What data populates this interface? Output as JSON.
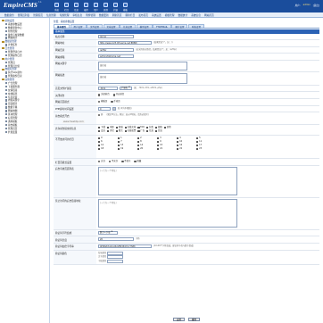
{
  "app": {
    "logo": "EmpireCMS",
    "logo_sub": "7.5",
    "user_label": "用户:",
    "username": "admin",
    "logout": "[退出]"
  },
  "topnav": [
    "系统",
    "栏目",
    "信息",
    "插件",
    "用户",
    "其他",
    "扩展",
    "模板"
  ],
  "menubar": [
    "数据备份",
    "管理员列表",
    "管理首页",
    "信息管理",
    "专题管理",
    "审核信息",
    "附件管理",
    "数据更新",
    "刷新首页",
    "刷新栏目",
    "发布首页",
    "系统设置",
    "模板管理",
    "数据统计",
    "系统信息",
    "网站首页"
  ],
  "sidebar": [
    {
      "label": "系统设置",
      "level": 1,
      "t": "f"
    },
    {
      "label": "系统参数设置",
      "level": 2,
      "t": "p"
    },
    {
      "label": "数据更新中心",
      "level": 2,
      "t": "p"
    },
    {
      "label": "附件管理",
      "level": 2,
      "t": "p"
    },
    {
      "label": "备份与恢复数据",
      "level": 2,
      "t": "p"
    },
    {
      "label": "网站统计",
      "level": 2,
      "t": "p"
    },
    {
      "label": "数据表管理",
      "level": 1,
      "t": "f"
    },
    {
      "label": "计划任务",
      "level": 2,
      "t": "p"
    },
    {
      "label": "日志管理",
      "level": 1,
      "t": "f"
    },
    {
      "label": "管理登录日志",
      "level": 2,
      "t": "p"
    },
    {
      "label": "管理操作日志",
      "level": 2,
      "t": "p"
    },
    {
      "label": "用户管理",
      "level": 1,
      "t": "f"
    },
    {
      "label": "管理员",
      "level": 2,
      "t": "p"
    },
    {
      "label": "管理员分组",
      "level": 2,
      "t": "p"
    },
    {
      "label": "数据库管理",
      "level": 1,
      "t": "f"
    },
    {
      "label": "执行SQL语句",
      "level": 2,
      "t": "p"
    },
    {
      "label": "管理备份目录",
      "level": 2,
      "t": "p"
    },
    {
      "label": "其他管理",
      "level": 1,
      "t": "f"
    },
    {
      "label": "广告管理",
      "level": 2,
      "t": "p"
    },
    {
      "label": "下载服务器",
      "level": 2,
      "t": "p"
    },
    {
      "label": "友情链接",
      "level": 2,
      "t": "p"
    },
    {
      "label": "在线投票",
      "level": 2,
      "t": "p"
    },
    {
      "label": "信息反馈",
      "level": 2,
      "t": "p"
    },
    {
      "label": "内容关键字",
      "level": 2,
      "t": "p"
    },
    {
      "label": "错误报告",
      "level": 2,
      "t": "p"
    },
    {
      "label": "数据字典",
      "level": 2,
      "t": "p"
    },
    {
      "label": "网站地图",
      "level": 2,
      "t": "p"
    },
    {
      "label": "区块管理",
      "level": 2,
      "t": "p"
    },
    {
      "label": "标签管理",
      "level": 2,
      "t": "p"
    },
    {
      "label": "通用模板",
      "level": 2,
      "t": "p"
    },
    {
      "label": "前台模板",
      "level": 2,
      "t": "p"
    },
    {
      "label": "管理首页",
      "level": 2,
      "t": "p"
    },
    {
      "label": "扩展变量",
      "level": 2,
      "t": "p"
    }
  ],
  "main": {
    "crumb": "位置：系统参数设置",
    "tabs": [
      "基本属性",
      "用户设置",
      "文件设置",
      "文章设置",
      "信息设置",
      "模型设置",
      "FTP/EMAIL",
      "图片设置",
      "附加设置"
    ],
    "section": "基本属性",
    "r_sitename_l": "站点名称",
    "r_sitename_v": "演示站",
    "r_url_l": "网站地址",
    "r_url_v": "http://www.123.0fcusma.net:8888/",
    "r_url_h": "(结尾需加\"/\"，如：/)",
    "r_path_l": "网站目录",
    "r_path_v": "/e/ftp/",
    "r_path_h": "(应采用绝对路径，结尾需加\"/\"，如：/e/ftp/)",
    "r_email_l": "网站邮箱",
    "r_email_v": "admin@phome.net",
    "r_kw_l": "网站关键字",
    "r_kw_v": "演示站",
    "r_desc_l": "网站描述",
    "r_desc_v": "演示站",
    "r_ext_l": "首页文件扩展名",
    "r_ext_v": ".html",
    "r_ext_sel": "扩展名",
    "r_ext_h": "(如：.html,.htm,.shtml,.php)",
    "r_close_l": "关闭前台",
    "r_close_o1": "关闭前台",
    "r_close_o2": "开启前台",
    "r_mode_l": "网站首页模式",
    "r_mode_o1": "模板页",
    "r_mode_o2": "手动页",
    "r_php_l": "PHP超时时间设置",
    "r_php_v": "0",
    "r_php_h": "秒 (0为不限制)",
    "r_ip_l": "前台模式开启",
    "r_ip_v": "开",
    "r_ip_h": "(限定IP方法，例如：如以IP地址，请务必填写)",
    "watermark": "www.hwsbtp.com",
    "r_cb_l": "允许前台提交的信息",
    "r_cb_row1": [
      "下载",
      "电影",
      "商城",
      "在线文章",
      "FAQ",
      "分类",
      "投稿",
      "其他"
    ],
    "r_cb_row2": [
      "会员",
      "评论",
      "留言",
      "在线投票",
      "广告",
      "信息",
      "信息"
    ],
    "r_grid_l": "不开放访问的栏目",
    "r_grid": [
      "0",
      "1",
      "2",
      "3",
      "4",
      "5",
      "6",
      "7",
      "8",
      "9",
      "10",
      "11",
      "12",
      "13",
      "14",
      "15",
      "16",
      "17",
      "18",
      "19",
      "20",
      "21",
      "22",
      "23"
    ],
    "r_mod_l": "栏目页模式设置",
    "r_mod_o1": "允许",
    "r_mod_o2": "不允许",
    "r_mod_o3": "不显示",
    "r_mod_o4": "隐藏",
    "r_dis_l": "后台有效页面列表",
    "r_dis_ph": "(一行为一个地址)",
    "r_ban_l": "禁止访问的后台链接地址",
    "r_ban_ph": "(一行为一个地址)",
    "r_verify_l": "验证码字符组成",
    "r_verify_v": "数字+字母",
    "r_len_l": "验证码长度",
    "r_len_v": "20",
    "r_len_h": "字符",
    "r_key_l": "验证码加密字符串",
    "r_key_v": "AfdZwtdu4uyJ4vjZ6hlZyhIcyYS8K",
    "r_key_h": "(10-60个字符组成，建议多字母与数字组成)",
    "r_col_l": "验证码颜色",
    "r_col_bg": "背景颜色",
    "r_col_fg": "文字颜色",
    "r_col_bd": "干扰颜色",
    "btn_submit": "设置",
    "btn_reset": "重置"
  }
}
